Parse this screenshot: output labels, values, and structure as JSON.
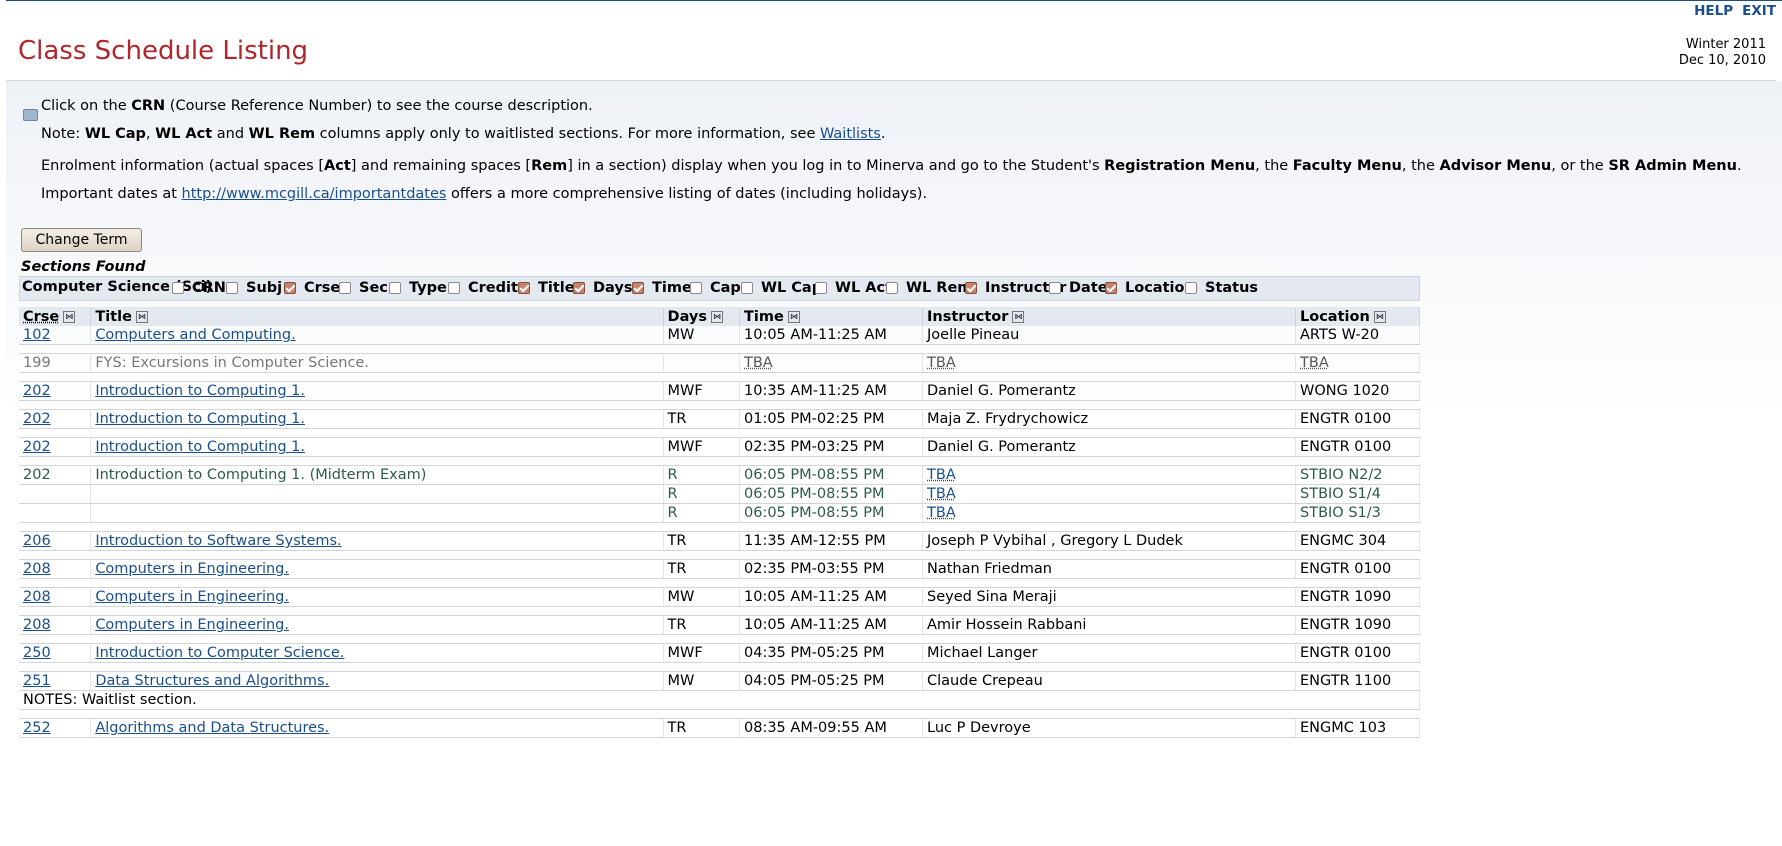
{
  "header": {
    "help_label": "HELP",
    "exit_label": "EXIT",
    "title": "Class Schedule Listing",
    "term": "Winter 2011",
    "date": "Dec 10, 2010"
  },
  "info": {
    "line1_pre": "Click on the ",
    "line1_bold": "CRN",
    "line1_post": " (Course Reference Number) to see the course description.",
    "line2_pre": "Note: ",
    "wl_cap": "WL Cap",
    "sep1": ", ",
    "wl_act": "WL Act",
    "and": " and ",
    "wl_rem": "WL Rem",
    "line2_mid": " columns apply only to waitlisted sections. For more information, see ",
    "waitlists_link": "Waitlists",
    "period": ".",
    "line3_a": "Enrolment information (actual spaces [",
    "act": "Act",
    "line3_b": "] and remaining spaces [",
    "rem": "Rem",
    "line3_c": "] in a section) display when you log in to Minerva and go to the Student's ",
    "reg_menu": "Registration Menu",
    "line3_d": ", the ",
    "fac_menu": "Faculty Menu",
    "line3_e": ", the ",
    "adv_menu": "Advisor Menu",
    "line3_f": ", or the ",
    "sr_menu": "SR Admin Menu",
    "line3_g": ".",
    "line4_pre": "Important dates at ",
    "dates_link": "http://www.mcgill.ca/importantdates",
    "line4_post": " offers a more comprehensive listing of dates (including holidays)."
  },
  "change_term_label": "Change Term",
  "sections_found_label": "Sections Found",
  "department": "Computer Science (Sci)",
  "column_toggles": [
    {
      "label": "CRN",
      "checked": false
    },
    {
      "label": "Subj",
      "checked": false
    },
    {
      "label": "Crse",
      "checked": true
    },
    {
      "label": "Sec",
      "checked": false
    },
    {
      "label": "Type",
      "checked": false
    },
    {
      "label": "Credits",
      "checked": false
    },
    {
      "label": "Title",
      "checked": true
    },
    {
      "label": "Days",
      "checked": true
    },
    {
      "label": "Time",
      "checked": true
    },
    {
      "label": "Cap",
      "checked": false
    },
    {
      "label": "WL Cap",
      "checked": false
    },
    {
      "label": "WL Act",
      "checked": false
    },
    {
      "label": "WL Rem",
      "checked": false
    },
    {
      "label": "Instructor",
      "checked": true
    },
    {
      "label": "Date",
      "checked": false
    },
    {
      "label": "Location",
      "checked": true
    },
    {
      "label": "Status",
      "checked": false
    }
  ],
  "table": {
    "headers": {
      "crse": "Crse",
      "title": "Title",
      "days": "Days",
      "time": "Time",
      "instructor": "Instructor",
      "location": "Location"
    },
    "rows": [
      {
        "crse": "102",
        "title": "Computers and Computing.",
        "days": "MW",
        "time": "10:05 AM-11:25 AM",
        "instructor": "Joelle Pineau",
        "location": "ARTS W-20",
        "style": "link"
      },
      {
        "crse": "199",
        "title": "FYS: Excursions in Computer Science.",
        "days": "",
        "time": "TBA",
        "instructor": "TBA",
        "location": "TBA",
        "style": "dim"
      },
      {
        "crse": "202",
        "title": "Introduction to Computing 1.",
        "days": "MWF",
        "time": "10:35 AM-11:25 AM",
        "instructor": "Daniel G. Pomerantz",
        "location": "WONG 1020",
        "style": "link"
      },
      {
        "crse": "202",
        "title": "Introduction to Computing 1.",
        "days": "TR",
        "time": "01:05 PM-02:25 PM",
        "instructor": "Maja Z. Frydrychowicz",
        "location": "ENGTR 0100",
        "style": "link"
      },
      {
        "crse": "202",
        "title": "Introduction to Computing 1.",
        "days": "MWF",
        "time": "02:35 PM-03:25 PM",
        "instructor": "Daniel G. Pomerantz",
        "location": "ENGTR 0100",
        "style": "link"
      },
      {
        "crse": "202",
        "title": "Introduction to Computing 1. (Midterm Exam)",
        "style": "exam",
        "sub": [
          {
            "days": "R",
            "time": "06:05 PM-08:55 PM",
            "instructor": "TBA",
            "location": "STBIO N2/2"
          },
          {
            "days": "R",
            "time": "06:05 PM-08:55 PM",
            "instructor": "TBA",
            "location": "STBIO S1/4"
          },
          {
            "days": "R",
            "time": "06:05 PM-08:55 PM",
            "instructor": "TBA",
            "location": "STBIO S1/3"
          }
        ]
      },
      {
        "crse": "206",
        "title": "Introduction to Software Systems.",
        "days": "TR",
        "time": "11:35 AM-12:55 PM",
        "instructor": "Joseph P Vybihal , Gregory L Dudek",
        "location": "ENGMC 304",
        "style": "link"
      },
      {
        "crse": "208",
        "title": "Computers in Engineering.",
        "days": "TR",
        "time": "02:35 PM-03:55 PM",
        "instructor": "Nathan Friedman",
        "location": "ENGTR 0100",
        "style": "link"
      },
      {
        "crse": "208",
        "title": "Computers in Engineering.",
        "days": "MW",
        "time": "10:05 AM-11:25 AM",
        "instructor": "Seyed Sina Meraji",
        "location": "ENGTR 1090",
        "style": "link"
      },
      {
        "crse": "208",
        "title": "Computers in Engineering.",
        "days": "TR",
        "time": "10:05 AM-11:25 AM",
        "instructor": "Amir Hossein Rabbani",
        "location": "ENGTR 1090",
        "style": "link"
      },
      {
        "crse": "250",
        "title": "Introduction to Computer Science.",
        "days": "MWF",
        "time": "04:35 PM-05:25 PM",
        "instructor": "Michael Langer",
        "location": "ENGTR 0100",
        "style": "link"
      },
      {
        "crse": "251",
        "title": "Data Structures and Algorithms.",
        "days": "MW",
        "time": "04:05 PM-05:25 PM",
        "instructor": "Claude Crepeau",
        "location": "ENGTR 1100",
        "style": "link",
        "notes": "NOTES: Waitlist section."
      },
      {
        "crse": "252",
        "title": "Algorithms and Data Structures.",
        "days": "TR",
        "time": "08:35 AM-09:55 AM",
        "instructor": "Luc P Devroye",
        "location": "ENGMC 103",
        "style": "link"
      }
    ]
  }
}
